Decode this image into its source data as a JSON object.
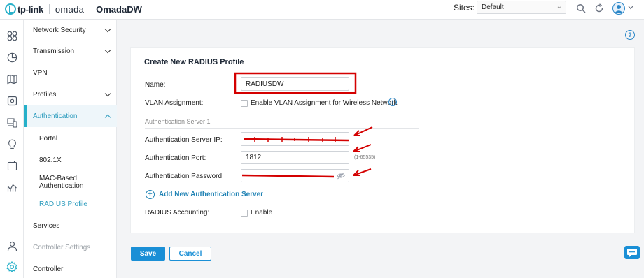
{
  "header": {
    "brand": "tp-link",
    "product": "omada",
    "app_title": "OmadaDW",
    "sites_label": "Sites:",
    "site_selected": "Default",
    "icons": [
      "search-icon",
      "refresh-icon",
      "user-avatar-icon"
    ]
  },
  "rail": {
    "icons": [
      "dashboard-icon",
      "statistics-icon",
      "map-icon",
      "devices-icon",
      "clients-icon",
      "insights-icon",
      "logs-icon",
      "reports-icon",
      "account-icon",
      "settings-icon"
    ],
    "active": "settings-icon"
  },
  "sidenav": {
    "network_security": "Network Security",
    "transmission": "Transmission",
    "vpn": "VPN",
    "profiles": "Profiles",
    "authentication": "Authentication",
    "portal": "Portal",
    "dot1x": "802.1X",
    "mac_auth": "MAC-Based Authentication",
    "radius_profile": "RADIUS Profile",
    "services": "Services",
    "controller_settings": "Controller Settings",
    "controller": "Controller"
  },
  "form": {
    "title": "Create New RADIUS Profile",
    "name_label": "Name:",
    "name_value": "RADIUSDW",
    "vlan_label": "VLAN Assignment:",
    "vlan_checkbox_label": "Enable VLAN Assignment for Wireless Network",
    "vlan_checked": false,
    "section_title": "Authentication Server 1",
    "server_ip_label": "Authentication Server IP:",
    "port_label": "Authentication Port:",
    "port_value": "1812",
    "port_hint": "(1-65535)",
    "password_label": "Authentication Password:",
    "add_server_label": "Add New Authentication Server",
    "accounting_label": "RADIUS Accounting:",
    "accounting_checkbox_label": "Enable",
    "accounting_checked": false
  },
  "actions": {
    "save": "Save",
    "cancel": "Cancel"
  },
  "colors": {
    "accent": "#26b0c9",
    "primary_button": "#1a8fd6",
    "annotation_red": "#d40000"
  }
}
